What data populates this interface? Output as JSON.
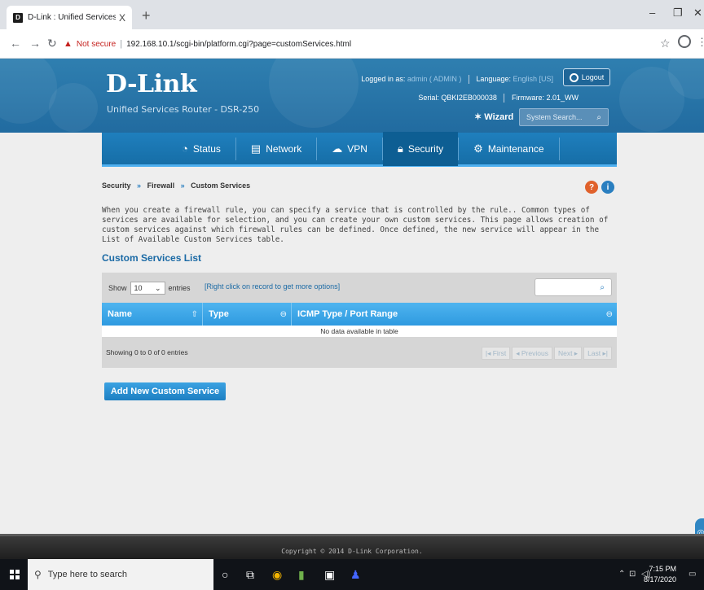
{
  "browser": {
    "tab_title": "D-Link : Unified Services Router",
    "tab_close": "X",
    "new_tab": "+",
    "security_label": "Not secure",
    "url": "192.168.10.1/scgi-bin/platform.cgi?page=customServices.html"
  },
  "header": {
    "logo": "D-Link",
    "subtitle": "Unified Services Router - DSR-250",
    "logged_in_label": "Logged in as:",
    "logged_in_value": "admin ( ADMIN )",
    "language_label": "Language:",
    "language_value": "English [US]",
    "logout_label": "Logout",
    "serial_label": "Serial:",
    "serial_value": "QBKI2EB000038",
    "firmware_label": "Firmware:",
    "firmware_value": "2.01_WW",
    "wizard_label": "Wizard",
    "search_placeholder": "System Search..."
  },
  "menu": [
    {
      "label": "Status",
      "icon": "gauge-icon"
    },
    {
      "label": "Network",
      "icon": "network-icon"
    },
    {
      "label": "VPN",
      "icon": "cloud-icon"
    },
    {
      "label": "Security",
      "icon": "lock-icon",
      "active": true
    },
    {
      "label": "Maintenance",
      "icon": "gears-icon"
    }
  ],
  "breadcrumb": {
    "items": [
      "Security",
      "Firewall",
      "Custom Services"
    ],
    "separator": "»"
  },
  "description": "When you create a firewall rule, you can specify a service that is controlled by the rule.. Common types of services are available for selection, and you can create your own custom services. This page allows creation of custom services against which firewall rules can be defined. Once defined, the new service will appear in the List of Available Custom Services table.",
  "section_title": "Custom Services List",
  "table": {
    "show_label": "Show",
    "entries_value": "10",
    "entries_label": "entries",
    "hint": "[Right click on record to get more options]",
    "columns": [
      "Name",
      "Type",
      "ICMP Type / Port Range"
    ],
    "empty_message": "No data available in table",
    "showing": "Showing 0 to 0 of 0 entries",
    "pager": [
      "First",
      "Previous",
      "Next",
      "Last"
    ]
  },
  "add_button": "Add New Custom Service",
  "footer": "Copyright © 2014 D-Link Corporation.",
  "taskbar": {
    "search_placeholder": "Type here to search",
    "time": "7:15 PM",
    "date": "8/17/2020"
  },
  "colors": {
    "header_blue": "#216ba0",
    "menu_blue": "#1f7fbd",
    "table_header": "#2e9ae0",
    "link_blue": "#1b6aa5"
  }
}
